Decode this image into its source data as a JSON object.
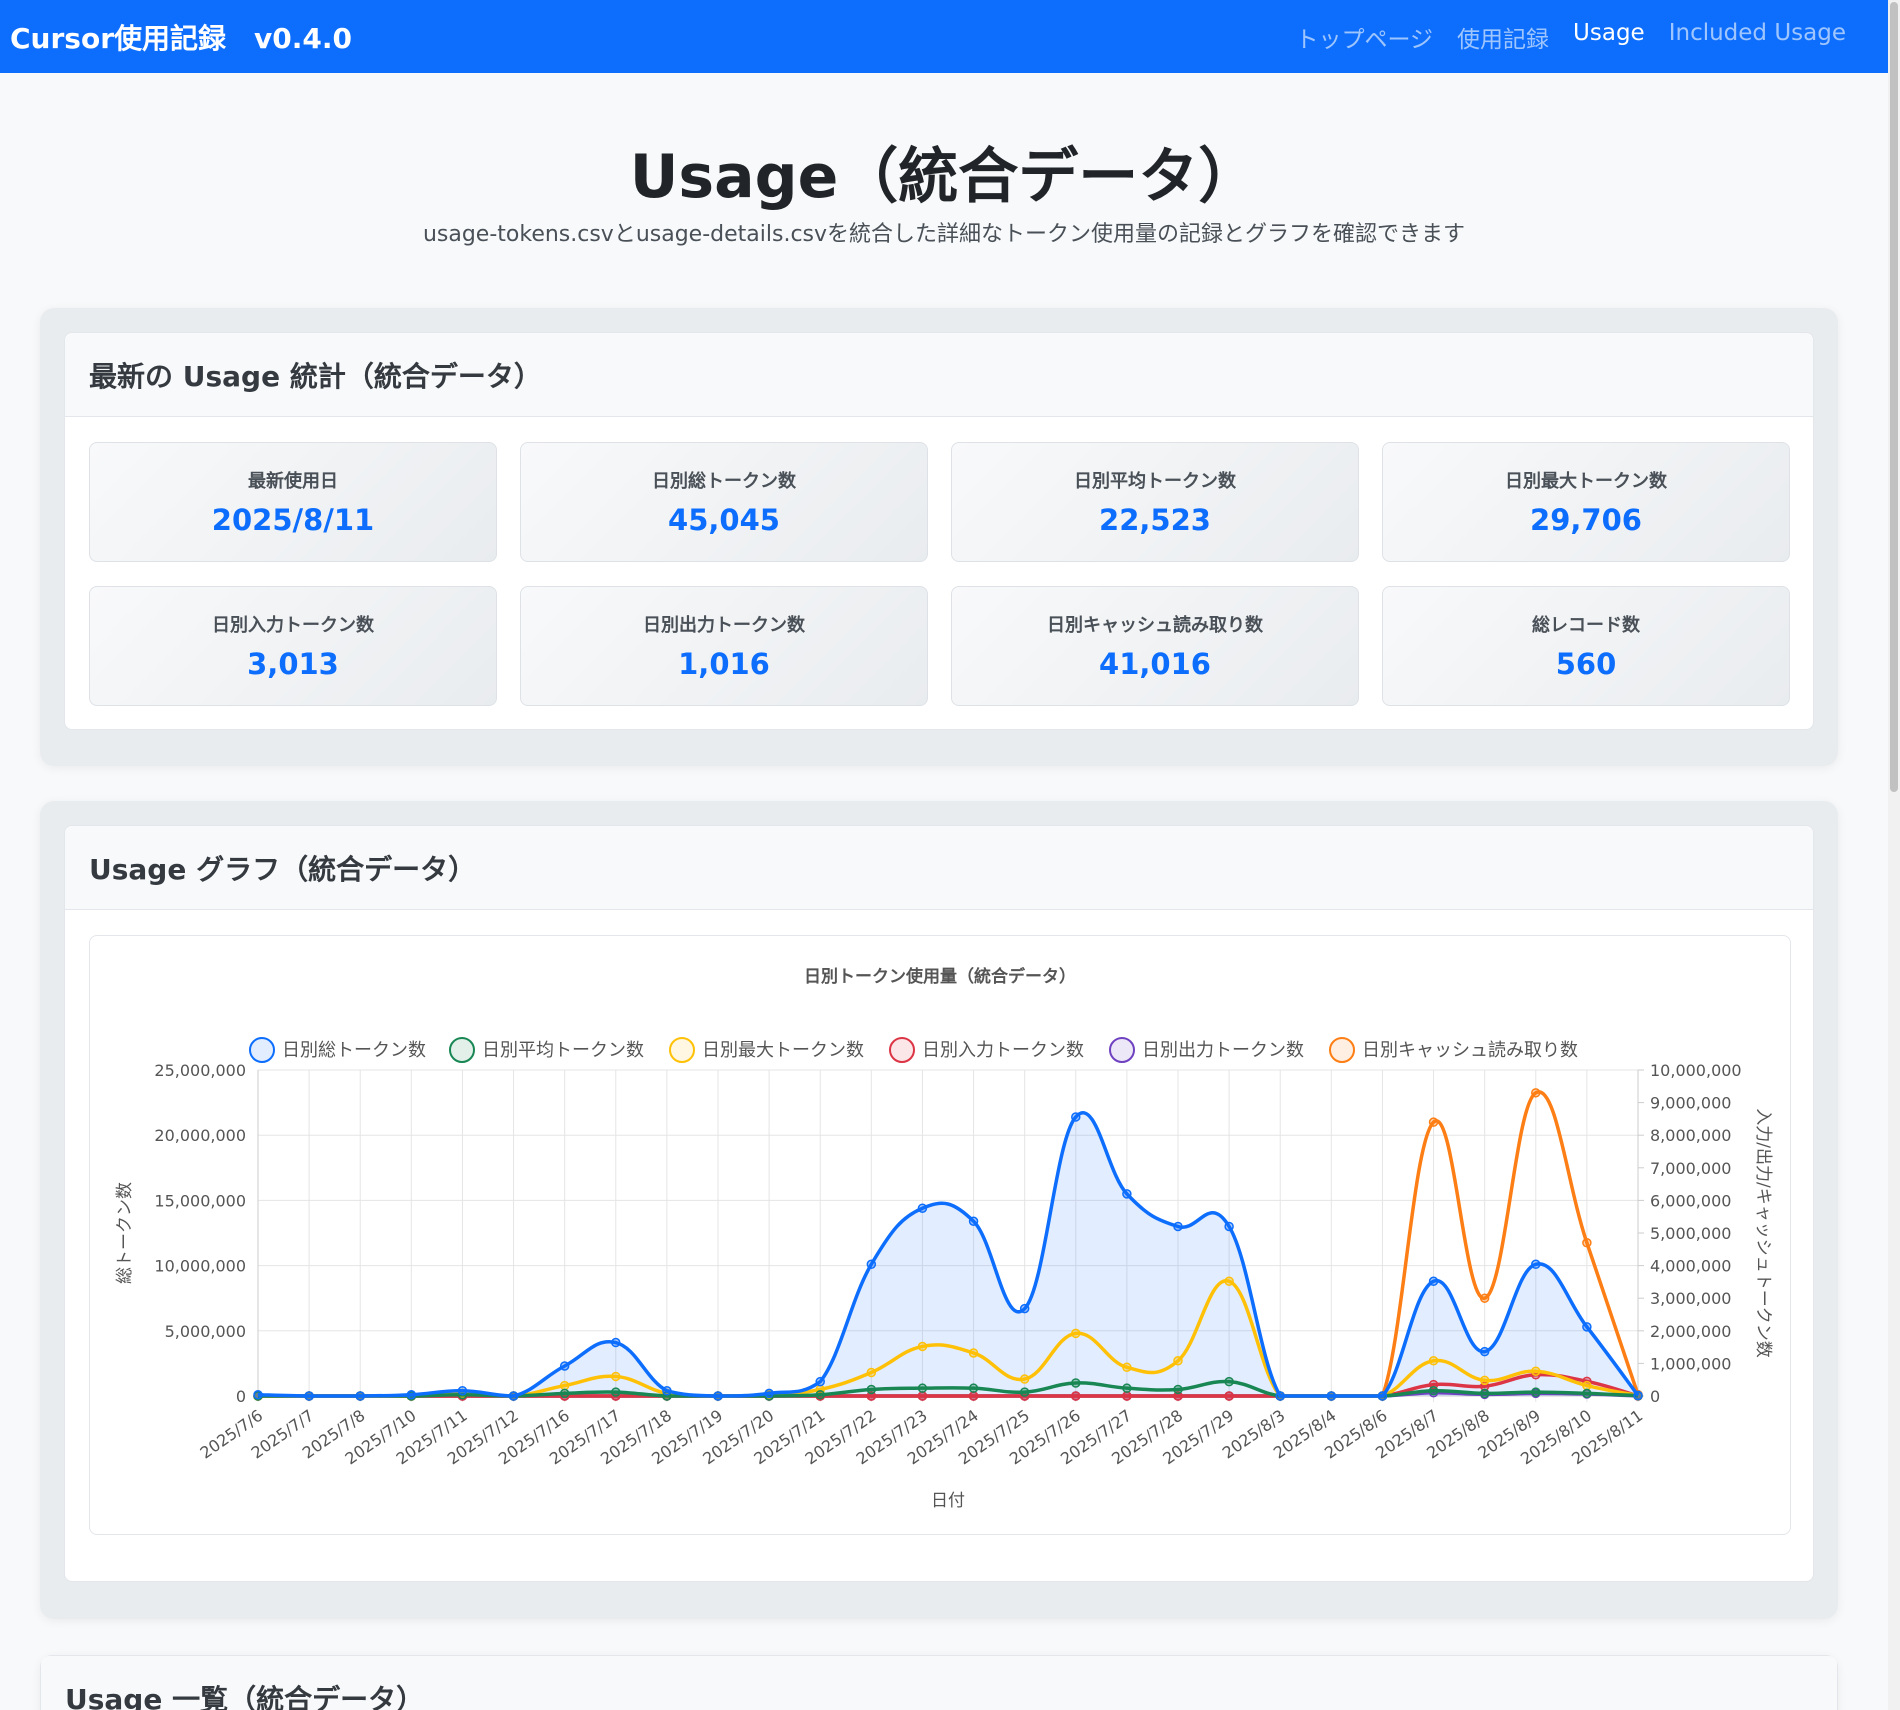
{
  "nav": {
    "brand": "Cursor使用記録　v0.4.0",
    "links": [
      "トップページ",
      "使用記録",
      "Usage",
      "Included Usage"
    ],
    "active": 2
  },
  "header": {
    "title": "Usage（統合データ）",
    "subtitle": "usage-tokens.csvとusage-details.csvを統合した詳細なトークン使用量の記録とグラフを確認できます"
  },
  "stats": {
    "title": "最新の Usage 統計（統合データ）",
    "items": [
      {
        "label": "最新使用日",
        "value": "2025/8/11"
      },
      {
        "label": "日別総トークン数",
        "value": "45,045"
      },
      {
        "label": "日別平均トークン数",
        "value": "22,523"
      },
      {
        "label": "日別最大トークン数",
        "value": "29,706"
      },
      {
        "label": "日別入力トークン数",
        "value": "3,013"
      },
      {
        "label": "日別出力トークン数",
        "value": "1,016"
      },
      {
        "label": "日別キャッシュ読み取り数",
        "value": "41,016"
      },
      {
        "label": "総レコード数",
        "value": "560"
      }
    ]
  },
  "graph": {
    "title": "Usage グラフ（統合データ）"
  },
  "list": {
    "title": "Usage 一覧（統合データ）"
  },
  "colors": {
    "primary": "#0d6efd",
    "total": "#0d6efd",
    "avg": "#198754",
    "max": "#ffc107",
    "input": "#dc3545",
    "output": "#6f42c1",
    "cache": "#fd7e14"
  },
  "chart_data": {
    "type": "line",
    "title": "日別トークン使用量（統合データ）",
    "xlabel": "日付",
    "ylabel": "総トークン数",
    "y2label": "入力/出力/キャッシュトークン数",
    "ylim": [
      0,
      25000000
    ],
    "y2lim": [
      0,
      10000000
    ],
    "yticks": [
      "0",
      "5,000,000",
      "10,000,000",
      "15,000,000",
      "20,000,000",
      "25,000,000"
    ],
    "y2ticks": [
      "0",
      "1,000,000",
      "2,000,000",
      "3,000,000",
      "4,000,000",
      "5,000,000",
      "6,000,000",
      "7,000,000",
      "8,000,000",
      "9,000,000",
      "10,000,000"
    ],
    "grid": true,
    "legend_position": "top",
    "categories": [
      "2025/7/6",
      "2025/7/7",
      "2025/7/8",
      "2025/7/10",
      "2025/7/11",
      "2025/7/12",
      "2025/7/16",
      "2025/7/17",
      "2025/7/18",
      "2025/7/19",
      "2025/7/20",
      "2025/7/21",
      "2025/7/22",
      "2025/7/23",
      "2025/7/24",
      "2025/7/25",
      "2025/7/26",
      "2025/7/27",
      "2025/7/28",
      "2025/7/29",
      "2025/8/3",
      "2025/8/4",
      "2025/8/6",
      "2025/8/7",
      "2025/8/8",
      "2025/8/9",
      "2025/8/10",
      "2025/8/11"
    ],
    "series": [
      {
        "name": "日別総トークン数",
        "axis": "left",
        "color": "#0d6efd",
        "fill": true,
        "values": [
          100000,
          0,
          0,
          100000,
          400000,
          0,
          2300000,
          4100000,
          400000,
          0,
          200000,
          1100000,
          10100000,
          14400000,
          13400000,
          6700000,
          21400000,
          15500000,
          13000000,
          13000000,
          0,
          0,
          0,
          8800000,
          3400000,
          10100000,
          5300000,
          45045
        ]
      },
      {
        "name": "日別平均トークン数",
        "axis": "left",
        "color": "#198754",
        "fill": false,
        "values": [
          0,
          0,
          0,
          0,
          100000,
          0,
          200000,
          300000,
          0,
          0,
          0,
          100000,
          500000,
          600000,
          600000,
          300000,
          1000000,
          600000,
          500000,
          1100000,
          0,
          0,
          0,
          400000,
          200000,
          300000,
          200000,
          22523
        ]
      },
      {
        "name": "日別最大トークン数",
        "axis": "left",
        "color": "#ffc107",
        "fill": false,
        "values": [
          0,
          0,
          0,
          0,
          200000,
          0,
          800000,
          1500000,
          200000,
          0,
          100000,
          500000,
          1800000,
          3800000,
          3300000,
          1300000,
          4800000,
          2200000,
          2700000,
          8800000,
          0,
          0,
          0,
          2700000,
          1200000,
          1900000,
          800000,
          29706
        ]
      },
      {
        "name": "日別入力トークン数",
        "axis": "right",
        "color": "#dc3545",
        "fill": false,
        "values": [
          0,
          0,
          0,
          0,
          0,
          0,
          0,
          0,
          0,
          0,
          0,
          0,
          0,
          0,
          0,
          0,
          0,
          0,
          0,
          0,
          0,
          0,
          0,
          350000,
          300000,
          650000,
          450000,
          3013
        ]
      },
      {
        "name": "日別出力トークン数",
        "axis": "right",
        "color": "#6f42c1",
        "fill": false,
        "values": [
          0,
          0,
          0,
          0,
          0,
          0,
          0,
          0,
          0,
          0,
          0,
          0,
          0,
          0,
          0,
          0,
          0,
          0,
          0,
          0,
          0,
          0,
          0,
          100000,
          50000,
          80000,
          60000,
          1016
        ]
      },
      {
        "name": "日別キャッシュ読み取り数",
        "axis": "right",
        "color": "#fd7e14",
        "fill": false,
        "values": [
          0,
          0,
          0,
          0,
          0,
          0,
          0,
          0,
          0,
          0,
          0,
          0,
          0,
          0,
          0,
          0,
          0,
          0,
          0,
          0,
          0,
          0,
          0,
          8400000,
          3000000,
          9300000,
          4700000,
          41016
        ]
      }
    ]
  }
}
